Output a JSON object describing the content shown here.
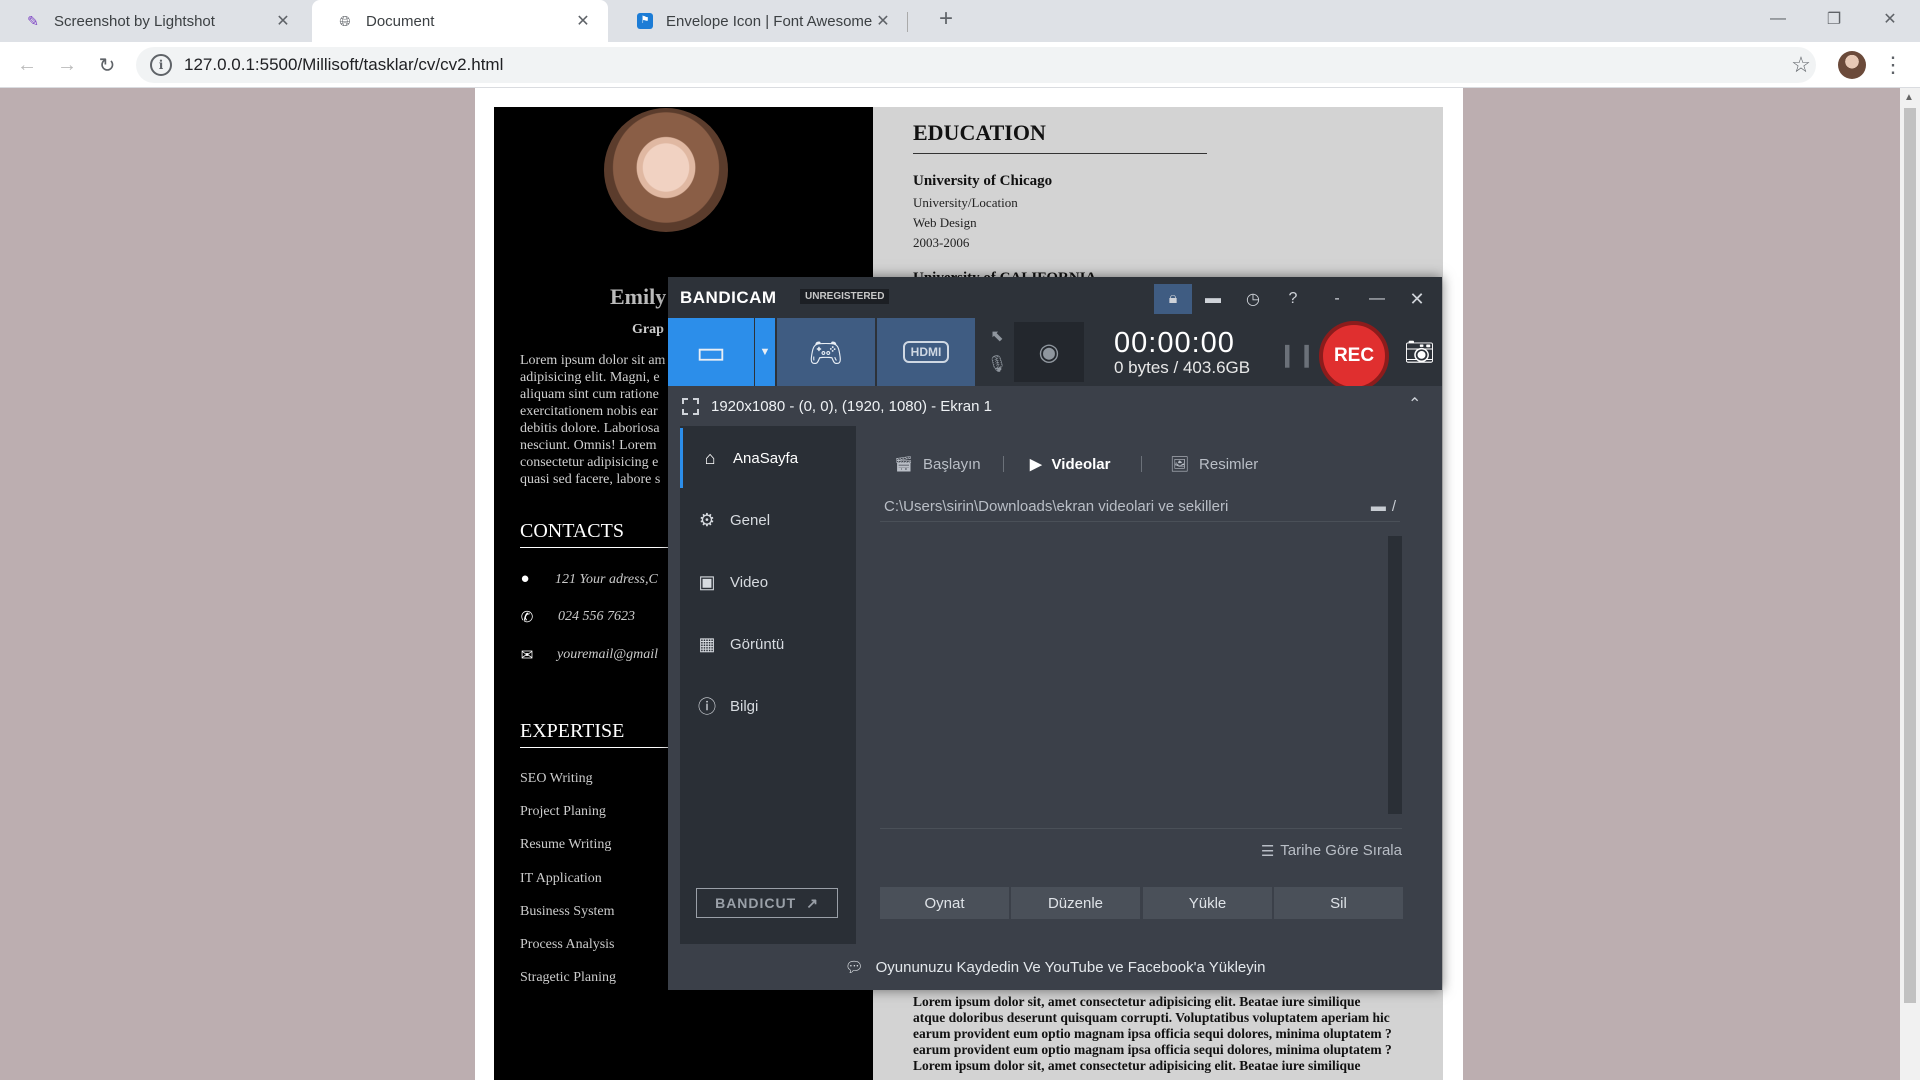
{
  "browser": {
    "tabs": [
      {
        "title": "Screenshot by Lightshot",
        "icon": "feather-icon"
      },
      {
        "title": "Document",
        "icon": "globe-icon"
      },
      {
        "title": "Envelope Icon | Font Awesome",
        "icon": "flag-icon"
      }
    ],
    "url": "127.0.0.1:5500/Millisoft/tasklar/cv/cv2.html"
  },
  "cv": {
    "name_partial": "Emily",
    "role_partial": "Grap",
    "about": "Lorem ipsum dolor sit am adipisicing elit. Magni, e aliquam sint cum ratione exercitationem nobis ear debitis dolore. Laboriosa nesciunt. Omnis! Lorem consectetur adipisicing e quasi sed facere, labore s",
    "contacts_heading": "CONTACTS",
    "contacts": [
      "121 Your adress,C",
      "024 556 7623",
      "youremail@gmail"
    ],
    "expertise_heading": "EXPERTISE",
    "expertise": [
      "SEO Writing",
      "Project Planing",
      "Resume Writing",
      "IT Application",
      "Business System",
      "Process Analysis",
      "Stragetic Planing"
    ],
    "education_heading": "EDUCATION",
    "education": {
      "school": "University of Chicago",
      "location": "University/Location",
      "field": "Web Design",
      "years": "2003-2006"
    },
    "education_next_partial": "University of CALIFORNIA",
    "bottom_text": [
      "Lorem ipsum dolor sit, amet consectetur adipisicing elit. Beatae iure similique",
      "atque doloribus deserunt quisquam corrupti. Voluptatibus voluptatem aperiam hic",
      "earum provident eum optio magnam ipsa officia sequi dolores, minima oluptatem ?",
      "earum provident eum optio magnam ipsa officia sequi dolores, minima oluptatem ?",
      "Lorem ipsum dolor sit, amet consectetur adipisicing elit. Beatae iure similique"
    ]
  },
  "bandicam": {
    "logo": "BANDICAM",
    "badge": "UNREGISTERED",
    "timer": "00:00:00",
    "size": "0 bytes / 403.6GB",
    "rec_label": "REC",
    "hdmi_label": "HDMI",
    "area": "1920x1080 - (0, 0), (1920, 1080) - Ekran 1",
    "sidebar": [
      "AnaSayfa",
      "Genel",
      "Video",
      "Görüntü",
      "Bilgi"
    ],
    "tabs": [
      "Başlayın",
      "Videolar",
      "Resimler"
    ],
    "path": "C:\\Users\\sirin\\Downloads\\ekran videolari ve sekilleri",
    "path_suffix": "/",
    "sort": "Tarihe Göre Sırala",
    "buttons": [
      "Oynat",
      "Düzenle",
      "Yükle",
      "Sil"
    ],
    "bandicut": "BANDICUT",
    "footer": "Oyununuzu Kaydedin Ve YouTube ve Facebook'a Yükleyin"
  }
}
